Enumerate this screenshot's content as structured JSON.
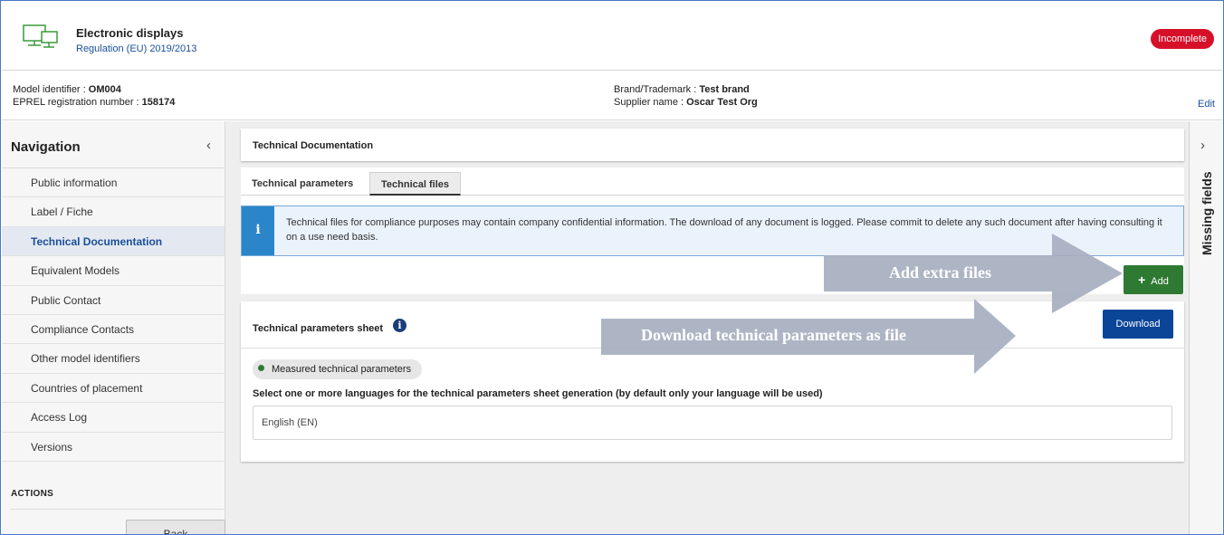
{
  "product": {
    "title": "Electronic displays",
    "regulation": "Regulation (EU) 2019/2013",
    "icon": "monitor-icon",
    "status": "Incomplete",
    "status_color": "#d7102a"
  },
  "model_info": {
    "model_identifier_label": "Model identifier : ",
    "model_identifier_value": "OM004",
    "eprel_label": "EPREL registration number : ",
    "eprel_value": "158174",
    "brand_label": "Brand/Trademark : ",
    "brand_value": "Test brand",
    "supplier_label": "Supplier name : ",
    "supplier_value": "Oscar Test Org",
    "edit_label": "Edit"
  },
  "navigation": {
    "title": "Navigation",
    "collapse_icon": "‹",
    "items": [
      {
        "label": "Public information",
        "active": false
      },
      {
        "label": "Label / Fiche",
        "active": false
      },
      {
        "label": "Technical Documentation",
        "active": true
      },
      {
        "label": "Equivalent Models",
        "active": false
      },
      {
        "label": "Public Contact",
        "active": false
      },
      {
        "label": "Compliance Contacts",
        "active": false
      },
      {
        "label": "Other model identifiers",
        "active": false
      },
      {
        "label": "Countries of placement",
        "active": false
      },
      {
        "label": "Access Log",
        "active": false
      },
      {
        "label": "Versions",
        "active": false
      }
    ],
    "actions_label": "ACTIONS",
    "back_label": "Back"
  },
  "main": {
    "section_title": "Technical Documentation",
    "tabs": [
      {
        "label": "Technical parameters",
        "active": false
      },
      {
        "label": "Technical files",
        "active": true
      }
    ],
    "info_icon": "i",
    "info_text": "Technical files for compliance purposes may contain company confidential information. The download of any document is logged. Please commit to delete any such document after having consulting it on a use need basis.",
    "add_label": "Add",
    "add_icon": "+",
    "add_color": "#2f7a33",
    "sheet_title": "Technical parameters sheet",
    "sheet_info_icon": "i",
    "download_label": "Download",
    "download_color": "#0a4598",
    "chip_label": "Measured technical parameters",
    "language_label": "Select one or more languages for the technical parameters sheet generation (by default only your language will be used)",
    "language_value": "English (EN)"
  },
  "right_rail": {
    "chevron": "›",
    "label": "Missing fields"
  },
  "annotations": {
    "add_extra_files": "Add extra files",
    "download_params": "Download technical parameters as file",
    "arrow_color": "#a6afc0"
  }
}
